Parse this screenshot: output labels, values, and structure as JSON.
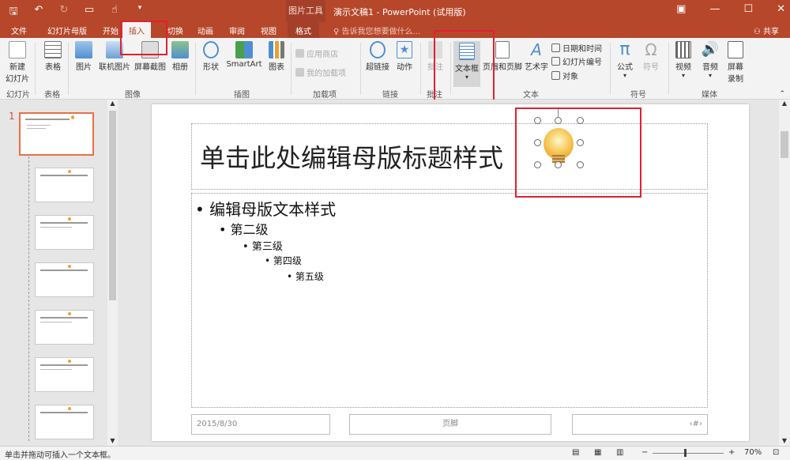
{
  "titlebar": {
    "context_tool": "图片工具",
    "doc_title": "演示文稿1 - PowerPoint (试用版)"
  },
  "tabs": {
    "file": "文件",
    "master": "幻灯片母版",
    "home": "开始",
    "insert": "插入",
    "transitions": "切换",
    "animations": "动画",
    "review": "审阅",
    "view": "视图",
    "format": "格式",
    "tell_me": "告诉我您想要做什么...",
    "share": "共享"
  },
  "ribbon": {
    "new_slide_1": "新建",
    "new_slide_2": "幻灯片",
    "table": "表格",
    "picture": "图片",
    "online_picture": "联机图片",
    "screenshot": "屏幕截图",
    "album": "相册",
    "shapes": "形状",
    "smartart": "SmartArt",
    "chart": "图表",
    "app_store": "应用商店",
    "my_addins": "我的加载项",
    "hyperlink": "超链接",
    "action": "动作",
    "comment": "批注",
    "textbox": "文本框",
    "header_footer": "页眉和页脚",
    "wordart": "艺术字",
    "date_time": "日期和时间",
    "slide_number": "幻灯片编号",
    "object": "对象",
    "equation": "公式",
    "symbol": "符号",
    "video": "视频",
    "audio": "音频",
    "screen_record_1": "屏幕",
    "screen_record_2": "录制",
    "groups": {
      "slides": "幻灯片",
      "tables": "表格",
      "images": "图像",
      "illustrations": "插图",
      "addins": "加载项",
      "links": "链接",
      "comments": "批注",
      "text": "文本",
      "symbols": "符号",
      "media": "媒体"
    }
  },
  "slide": {
    "number": "1",
    "title": "单击此处编辑母版标题样式",
    "level1": "编辑母版文本样式",
    "level2": "第二级",
    "level3": "第三级",
    "level4": "第四级",
    "level5": "第五级",
    "date": "2015/8/30",
    "footer": "页脚",
    "page_num": "‹#›"
  },
  "status": {
    "hint": "单击并拖动可插入一个文本框。",
    "zoom": "70%"
  },
  "colors": {
    "accent": "#b7472a",
    "highlight_box": "#e0212f"
  }
}
